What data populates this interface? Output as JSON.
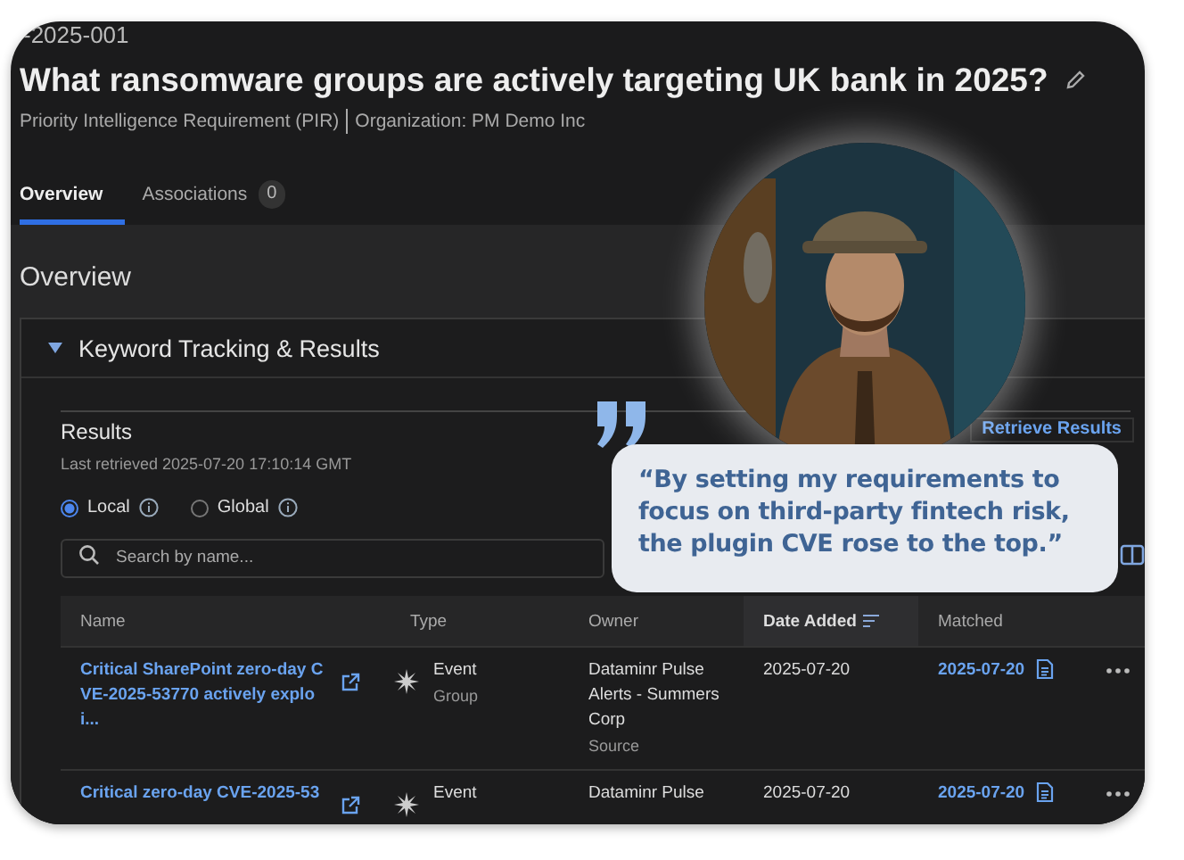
{
  "record_id": "-2025-001",
  "title": "What ransomware groups are actively targeting UK bank in 2025?",
  "subtitle": {
    "type": "Priority Intelligence Requirement (PIR)",
    "organization": "Organization: PM Demo Inc"
  },
  "tabs": [
    {
      "label": "Overview",
      "selected": true
    },
    {
      "label": "Associations",
      "count": "0",
      "selected": false
    }
  ],
  "section_title": "Overview",
  "panel": {
    "title": "Keyword Tracking & Results",
    "expanded": true,
    "results_title": "Results",
    "last_retrieved": "Last retrieved 2025-07-20 17:10:14 GMT",
    "retrieve_button": "Retrieve Results",
    "scope_options": [
      {
        "label": "Local",
        "selected": true
      },
      {
        "label": "Global",
        "selected": false
      }
    ],
    "search": {
      "placeholder": "Search by name..."
    },
    "table": {
      "columns": [
        {
          "label": "Name",
          "sorted": false
        },
        {
          "label": "Type",
          "sorted": false
        },
        {
          "label": "Owner",
          "sorted": false
        },
        {
          "label": "Date Added",
          "sorted": true
        },
        {
          "label": "Matched",
          "sorted": false
        }
      ],
      "rows": [
        {
          "name": "Critical SharePoint zero-day CVE-2025-53770 actively exploi...",
          "type": "Event",
          "type_detail": "Group",
          "owner": "Dataminr Pulse Alerts - Summers Corp",
          "owner_detail": "Source",
          "date_added": "2025-07-20",
          "matched": "2025-07-20"
        },
        {
          "name": "Critical zero-day CVE-2025-53",
          "type": "Event",
          "owner": "Dataminr Pulse",
          "date_added": "2025-07-20",
          "matched": "2025-07-20"
        }
      ]
    }
  },
  "testimonial": {
    "quote": "“By setting my requirements to focus on third-party fintech risk, the plugin CVE rose to the top.”"
  }
}
